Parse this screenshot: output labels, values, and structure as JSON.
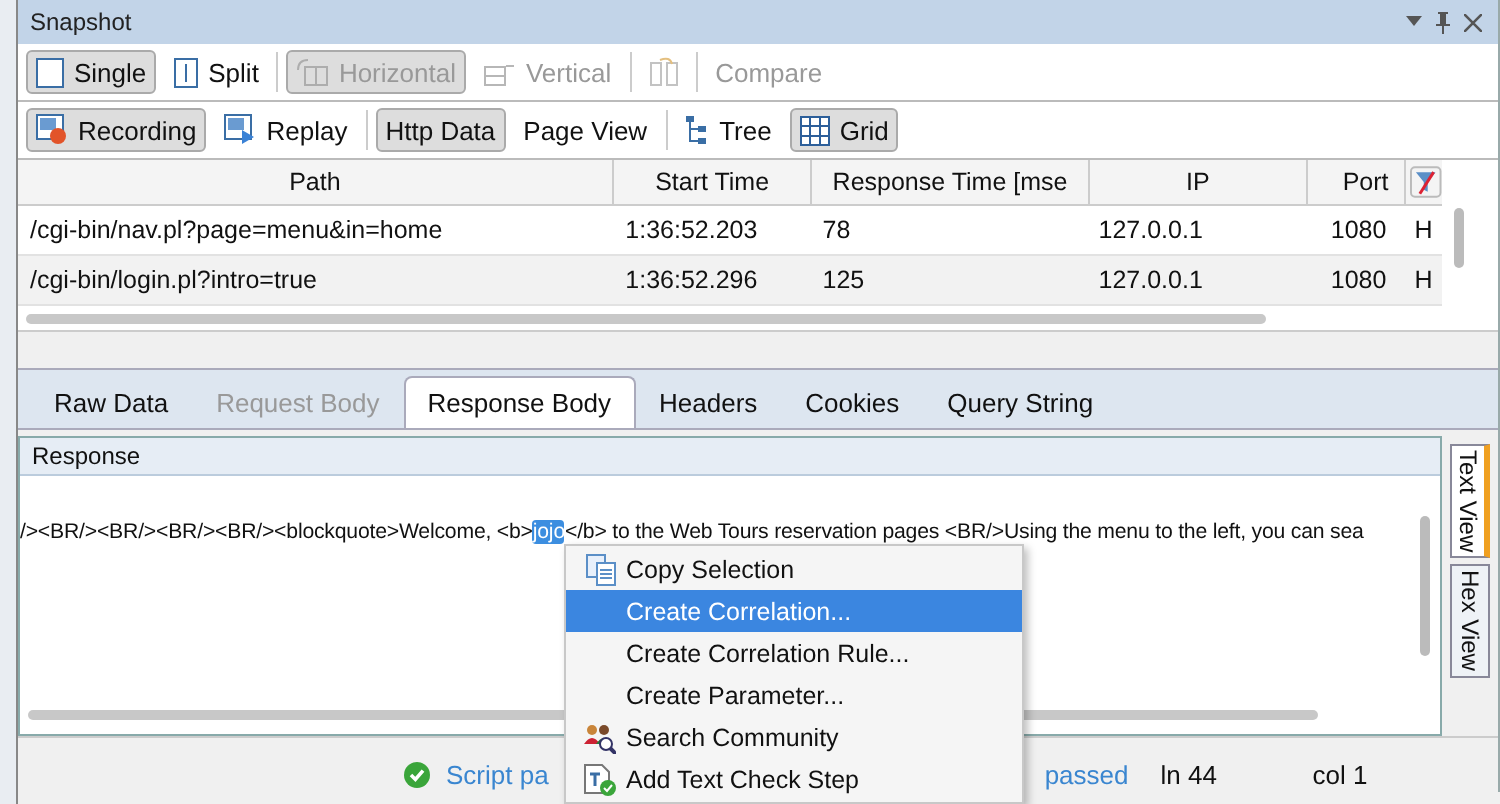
{
  "window": {
    "title": "Snapshot"
  },
  "toolbar_1": [
    {
      "label": "Single",
      "selected": true,
      "disabled": false
    },
    {
      "label": "Split",
      "selected": false,
      "disabled": false
    },
    {
      "label": "Horizontal",
      "selected": true,
      "disabled": true
    },
    {
      "label": "Vertical",
      "selected": false,
      "disabled": true
    },
    {
      "selected": false,
      "disabled": true
    },
    {
      "label": "Compare",
      "selected": false,
      "disabled": true
    }
  ],
  "toolbar_2": [
    {
      "label": "Recording",
      "selected": true
    },
    {
      "label": "Replay",
      "selected": false
    },
    {
      "label": "Http Data",
      "selected": true
    },
    {
      "label": "Page View",
      "selected": false
    },
    {
      "label": "Tree",
      "selected": false
    },
    {
      "label": "Grid",
      "selected": true
    }
  ],
  "table": {
    "columns": [
      "Path",
      "Start Time",
      "Response Time [mse",
      "IP",
      "Port"
    ],
    "rows": [
      {
        "selected": false,
        "cells": [
          "/cgi-bin/nav.pl?page=menu&in=home",
          "1:36:52.203",
          "78",
          "127.0.0.1",
          "1080",
          "H"
        ]
      },
      {
        "selected": true,
        "cells": [
          "/cgi-bin/login.pl?intro=true",
          "1:36:52.296",
          "125",
          "127.0.0.1",
          "1080",
          "H"
        ]
      }
    ]
  },
  "tabs": [
    {
      "label": "Raw Data",
      "selected": false,
      "disabled": false
    },
    {
      "label": "Request Body",
      "selected": false,
      "disabled": true
    },
    {
      "label": "Response Body",
      "selected": true,
      "disabled": false
    },
    {
      "label": "Headers",
      "selected": false,
      "disabled": false
    },
    {
      "label": "Cookies",
      "selected": false,
      "disabled": false
    },
    {
      "label": "Query String",
      "selected": false,
      "disabled": false
    }
  ],
  "response": {
    "title": "Response",
    "text_before": "/><BR/><BR/><BR/><BR/><blockquote>Welcome, <b>",
    "selection": "jojo",
    "text_after": "</b>  to the Web Tours reservation pages <BR/>Using the menu to the left, you can sea"
  },
  "view_tabs": [
    {
      "label": "Text View",
      "selected": true
    },
    {
      "label": "Hex View",
      "selected": false
    }
  ],
  "status_bar": {
    "message_start": "Script pa",
    "message_end": "passed",
    "line": "ln 44",
    "column": "col 1"
  },
  "context_menu": [
    {
      "label": "Copy Selection",
      "selected": false
    },
    {
      "label": "Create Correlation...",
      "selected": true
    },
    {
      "label": "Create Correlation Rule...",
      "selected": false
    },
    {
      "label": "Create Parameter...",
      "selected": false
    },
    {
      "label": "Search Community",
      "selected": false
    },
    {
      "label": "Add Text Check Step",
      "selected": false
    }
  ]
}
